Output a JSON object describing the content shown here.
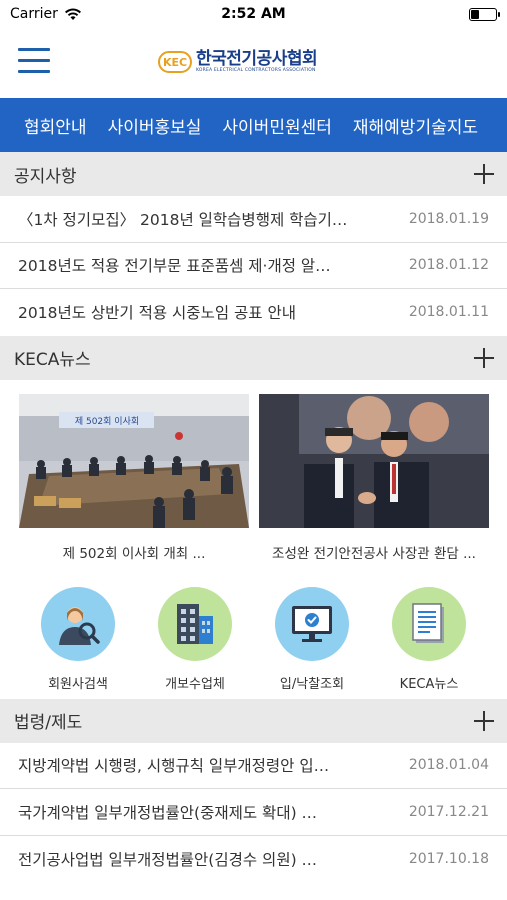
{
  "status_bar": {
    "carrier": "Carrier",
    "time": "2:52 AM",
    "battery_level": 0.35
  },
  "header": {
    "logo_mark": "KEC",
    "logo_title": "한국전기공사협회",
    "logo_sub": "KOREA ELECTRICAL CONTRACTORS ASSOCIATION"
  },
  "nav": {
    "items": [
      "협회안내",
      "사이버홍보실",
      "사이버민원센터",
      "재해예방기술지도"
    ]
  },
  "notices": {
    "title": "공지사항",
    "items": [
      {
        "title": "〈1차 정기모집〉 2018년 일학습병행제 학습기…",
        "date": "2018.01.19"
      },
      {
        "title": "2018년도 적용 전기부문 표준품셈 제·개정 알…",
        "date": "2018.01.12"
      },
      {
        "title": "2018년도 상반기 적용 시중노임 공표 안내",
        "date": "2018.01.11"
      }
    ]
  },
  "news": {
    "title": "KECA뉴스",
    "items": [
      {
        "caption": "제 502회 이사회 개최 ...",
        "banner_text": "제 502회 이사회"
      },
      {
        "caption": "조성완 전기안전공사 사장관 환담 ..."
      }
    ]
  },
  "quick_links": [
    {
      "label": "회원사검색",
      "icon": "member-search-icon",
      "color": "#8fd0f0"
    },
    {
      "label": "개보수업체",
      "icon": "building-icon",
      "color": "#bfe39a"
    },
    {
      "label": "입/낙찰조회",
      "icon": "monitor-check-icon",
      "color": "#8fd0f0"
    },
    {
      "label": "KECA뉴스",
      "icon": "document-icon",
      "color": "#bfe39a"
    }
  ],
  "laws": {
    "title": "법령/제도",
    "items": [
      {
        "title": "지방계약법 시행령, 시행규칙 일부개정령안 입…",
        "date": "2018.01.04"
      },
      {
        "title": "국가계약법 일부개정법률안(중재제도 확대) …",
        "date": "2017.12.21"
      },
      {
        "title": "전기공사업법 일부개정법률안(김경수 의원) …",
        "date": "2017.10.18"
      }
    ]
  },
  "colors": {
    "nav_bg": "#2164c4",
    "section_bg": "#e9e9e9",
    "logo_blue": "#1a3f8a",
    "logo_orange": "#e8a020"
  }
}
